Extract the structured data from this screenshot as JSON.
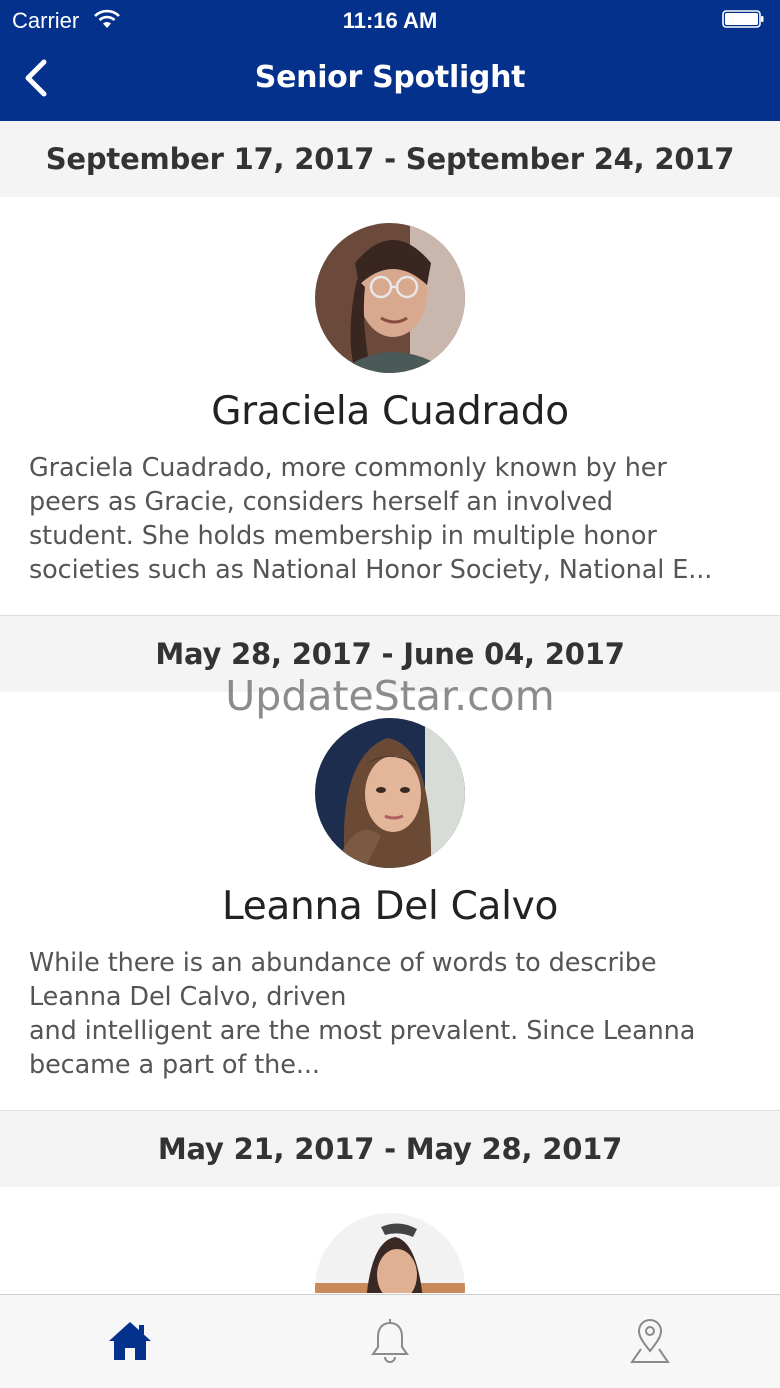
{
  "status_bar": {
    "carrier": "Carrier",
    "time": "11:16 AM"
  },
  "nav": {
    "title": "Senior Spotlight"
  },
  "spotlights": [
    {
      "date_range": "September 17, 2017 - September 24, 2017",
      "name": "Graciela Cuadrado",
      "bio": "Graciela Cuadrado, more commonly known by her\npeers as Gracie, considers herself an involved\nstudent. She holds membership in multiple honor\nsocieties such as National Honor Society, National E..."
    },
    {
      "date_range": "May 28, 2017 - June 04, 2017",
      "name": "Leanna Del Calvo",
      "bio": "While there is an abundance of words to describe\nLeanna Del Calvo, driven\nand intelligent are the most prevalent. Since Leanna\nbecame a part of the..."
    },
    {
      "date_range": "May 21, 2017 - May 28, 2017"
    }
  ],
  "watermark": "UpdateStar.com",
  "tab_bar": {
    "tabs": [
      "home-icon",
      "bell-icon",
      "location-pin-icon"
    ],
    "active": "home-icon"
  },
  "colors": {
    "brand": "#03318c",
    "header_bg": "#f4f4f4",
    "tab_bg": "#f7f7f7",
    "icon_inactive": "#8a8a8a"
  }
}
